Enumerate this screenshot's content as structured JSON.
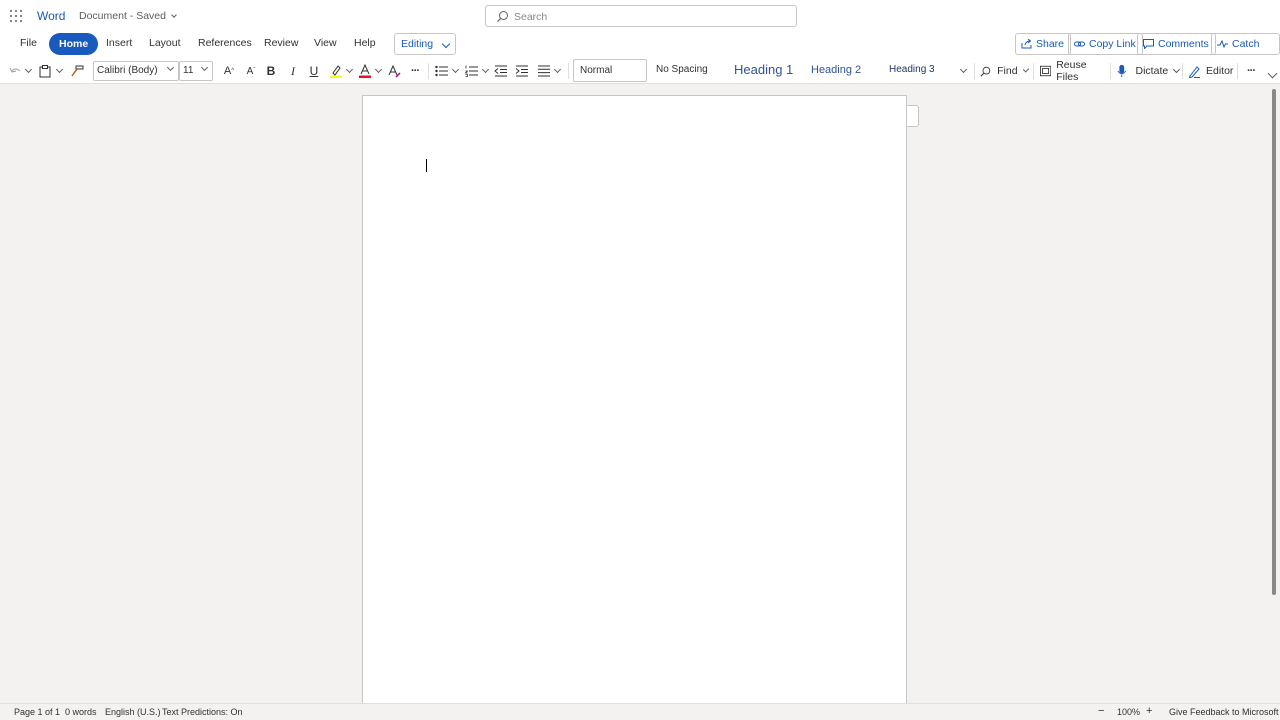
{
  "app": {
    "name": "Word",
    "doc_name": "Document",
    "save_status": "Saved"
  },
  "search": {
    "placeholder": "Search"
  },
  "tabs": [
    "File",
    "Home",
    "Insert",
    "Layout",
    "References",
    "Review",
    "View",
    "Help"
  ],
  "active_tab": "Home",
  "mode": {
    "label": "Editing"
  },
  "actions": {
    "share": "Share",
    "copy_link": "Copy Link",
    "comments": "Comments",
    "catch_up": "Catch up"
  },
  "ribbon": {
    "font_name": "Calibri (Body)",
    "font_size": "11",
    "bold": "B",
    "italic": "I",
    "underline": "U",
    "grow_font": "A",
    "shrink_font": "A",
    "more": "···",
    "styles": [
      "Normal",
      "No Spacing",
      "Heading 1",
      "Heading 2",
      "Heading 3"
    ],
    "find": "Find",
    "reuse_files": "Reuse Files",
    "dictate": "Dictate",
    "editor": "Editor",
    "more_options": "···"
  },
  "status": {
    "page": "Page 1 of 1",
    "words": "0 words",
    "language": "English (U.S.)",
    "text_predictions": "Text Predictions: On",
    "zoom_out": "−",
    "zoom": "100%",
    "zoom_in": "+",
    "feedback": "Give Feedback to Microsoft"
  },
  "colors": {
    "accent": "#185abd",
    "highlight": "#ffff00",
    "font_color": "#e81123"
  }
}
